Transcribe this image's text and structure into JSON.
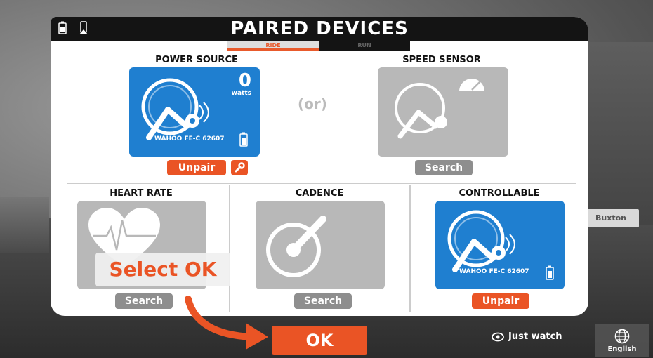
{
  "panel": {
    "title": "PAIRED DEVICES",
    "tabs": [
      {
        "label": "RIDE",
        "active": true
      },
      {
        "label": "RUN",
        "active": false
      }
    ]
  },
  "power_source": {
    "title": "POWER SOURCE",
    "value": "0",
    "unit": "watts",
    "device": "WAHOO FE-C 62607",
    "unpair_label": "Unpair",
    "wrench_icon": "wrench-icon"
  },
  "or_label": "(or)",
  "speed_sensor": {
    "title": "SPEED SENSOR",
    "search_label": "Search"
  },
  "heart_rate": {
    "title": "HEART RATE",
    "search_label": "Search"
  },
  "cadence": {
    "title": "CADENCE",
    "search_label": "Search"
  },
  "controllable": {
    "title": "CONTROLLABLE",
    "device": "WAHOO FE-C 62607",
    "unpair_label": "Unpair"
  },
  "annotation": {
    "text": "Select OK"
  },
  "footer": {
    "ok_label": "OK",
    "just_watch_label": "Just watch",
    "language_label": "English"
  },
  "background": {
    "banner": "Buxton"
  },
  "colors": {
    "accent": "#ea5425",
    "device_blue": "#1f7fd0",
    "inactive_gray": "#b8b8b8"
  }
}
